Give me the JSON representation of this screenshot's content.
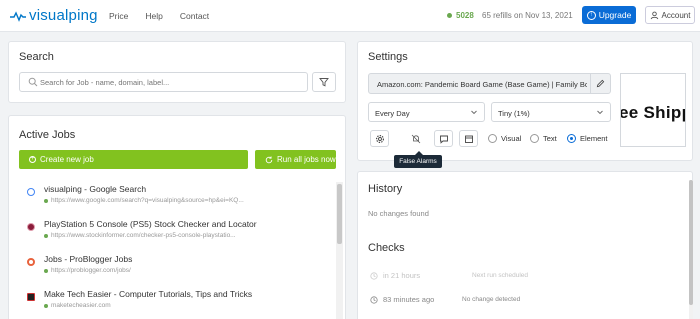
{
  "header": {
    "brand": "visualping",
    "nav": [
      "Price",
      "Help",
      "Contact"
    ],
    "credits": "5028",
    "refills": "65 refills on Nov 13, 2021",
    "upgrade_label": "Upgrade",
    "account_label": "Account"
  },
  "search": {
    "title": "Search",
    "placeholder": "Search for Job - name, domain, label..."
  },
  "jobs": {
    "title": "Active Jobs",
    "create_label": "Create new job",
    "run_all_label": "Run all jobs now",
    "items": [
      {
        "title": "visualping - Google Search",
        "url": "https://www.google.com/search?q=visualping&source=hp&ei=KQ...",
        "favicon_color": "#4285f4"
      },
      {
        "title": "PlayStation 5 Console (PS5) Stock Checker and Locator",
        "url": "https://www.stockinformer.com/checker-ps5-console-playstatio...",
        "favicon_color": "#8a1c3a"
      },
      {
        "title": "Jobs - ProBlogger Jobs",
        "url": "https://problogger.com/jobs/",
        "favicon_color": "#e8623c"
      },
      {
        "title": "Make Tech Easier - Computer Tutorials, Tips and Tricks",
        "url": "maketecheasier.com",
        "favicon_color": "#222222"
      }
    ]
  },
  "settings": {
    "title": "Settings",
    "job_name": "Amazon.com: Pandemic Board Game (Base Game) | Family Bo",
    "frequency": "Every Day",
    "sensitivity": "Tiny (1%)",
    "preview_text": "ee Shipp",
    "tooltip": "False Alarms",
    "modes": [
      "Visual",
      "Text",
      "Element"
    ],
    "selected_mode": "Element"
  },
  "history": {
    "title": "History",
    "empty_text": "No changes found"
  },
  "checks": {
    "title": "Checks",
    "rows": [
      {
        "time": "in 21 hours",
        "status": "Next run scheduled"
      },
      {
        "time": "83 minutes ago",
        "status": "No change detected"
      }
    ]
  },
  "colors": {
    "brand": "#0077c8",
    "accent_green": "#82c21f",
    "primary_blue": "#0a6cd6"
  }
}
